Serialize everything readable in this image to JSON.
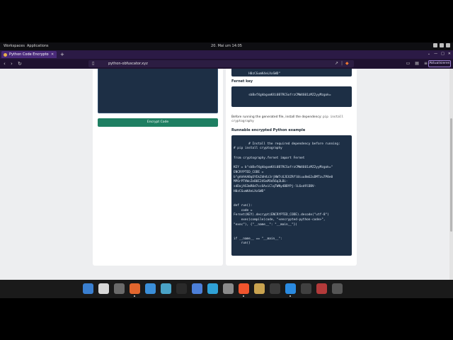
{
  "topbar": {
    "workspaces": "Workspaces",
    "applications": "Applications",
    "clock": "20. Mai um 14:05"
  },
  "browser": {
    "tab_title": "Python Code Encryptor",
    "new_tab": "+",
    "url": "python-obfuscator.xyz",
    "update_button": "Aktualisieren"
  },
  "left_panel": {
    "encrypt_button": "Encrypt Code"
  },
  "right_panel": {
    "top_code_fragment": "H0zCGumK4eLXxSWD\"",
    "fernet_label": "Fernet key",
    "fernet_key": "sbBxfXgkbgxmKXi0B7RCSofrzCMW4601zMZ2yyMzgok=",
    "install_note": "Before running the generated file, install the dependency:",
    "install_cmd": "pip install cryptography",
    "example_label": "Runnable encrypted Python example",
    "example_code": "# Install the required dependency before running:\n# pip install cryptography\n\nfrom cryptography.fernet import Fernet\n\nKEY = b\"sbBxfXgkbgxmKXi0B7RCSofrzCMW4601zMZ2yyMzgok=\"\nENCRYPTED_CODE =\nb\"gAAAAABqOYEkZdH4z3rjNW7c6JEXZRfl0iuu8mG2uDMTzu7P8e0\nMPOrPTVWcZeB0I24SmPDd56q3LBi-\nsdDajAS3mR0d7ccOAxiClqTWNy4BBYPj-lL6xd9lDBV-\nH0zCGumK4eLXxSWD\"\n\n\ndef run():\n    code =\nFernet(KEY).decrypt(ENCRYPTED_CODE).decode(\"utf-8\")\n    exec(compile(code, \"<encrypted-python-code>\",\n\"exec\"), {\"__name__\": \"__main__\"})\n\n\nif __name__ == \"__main__\":\n    run()"
  },
  "dock": {
    "apps": [
      {
        "name": "screenshot-app-icon",
        "color": "#3a7fd0"
      },
      {
        "name": "window-switcher-icon",
        "color": "#d8d8d8"
      },
      {
        "name": "app-grid-icon",
        "color": "#6a6a6a"
      },
      {
        "name": "firefox-icon",
        "color": "#e2662e"
      },
      {
        "name": "files-icon",
        "color": "#3b8fd9"
      },
      {
        "name": "text-editor-icon",
        "color": "#4aa3c7"
      },
      {
        "name": "terminal-icon",
        "color": "#2a2a2a"
      },
      {
        "name": "software-store-icon",
        "color": "#4c7fd8"
      },
      {
        "name": "virtualbox-icon",
        "color": "#2fa1d6"
      },
      {
        "name": "settings-icon",
        "color": "#8a8a8a"
      },
      {
        "name": "brave-browser-icon",
        "color": "#f0542d"
      },
      {
        "name": "gimp-icon",
        "color": "#c9a34f"
      },
      {
        "name": "obs-studio-icon",
        "color": "#3a3a3a"
      },
      {
        "name": "vscode-icon",
        "color": "#2a8ae0"
      },
      {
        "name": "monitor-icon",
        "color": "#404040"
      },
      {
        "name": "record-icon",
        "color": "#b33a3a"
      },
      {
        "name": "console-icon",
        "color": "#555555"
      }
    ]
  }
}
